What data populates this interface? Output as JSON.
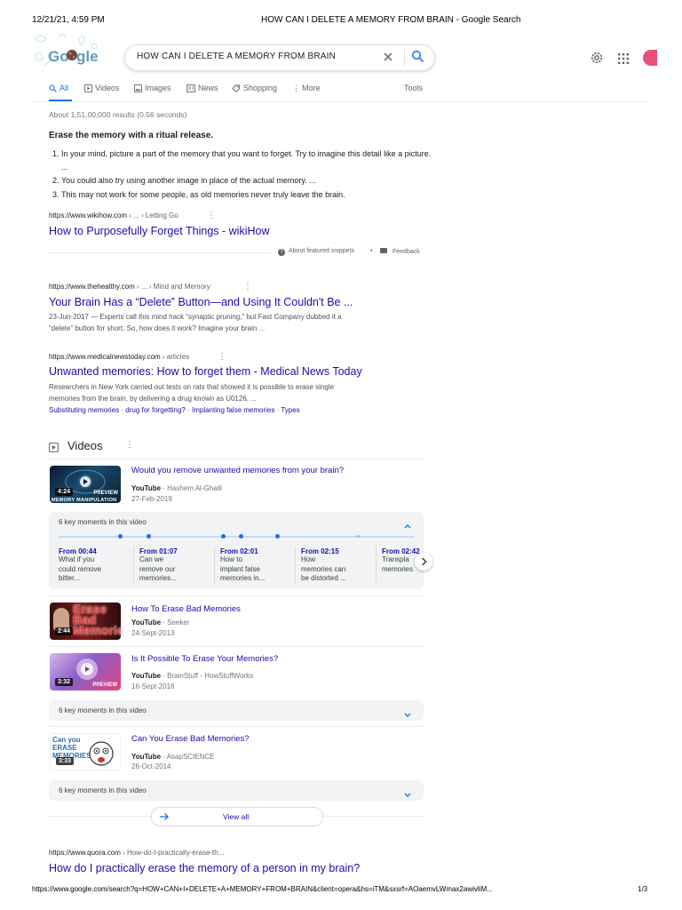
{
  "print_header": {
    "datetime": "12/21/21, 4:59 PM",
    "page_title": "HOW CAN I DELETE A MEMORY FROM BRAIN - Google Search"
  },
  "search": {
    "query": "HOW CAN I DELETE A MEMORY FROM BRAIN"
  },
  "tabs": [
    {
      "label": "All",
      "icon": "search-icon",
      "active": true
    },
    {
      "label": "Videos",
      "icon": "play-icon"
    },
    {
      "label": "Images",
      "icon": "image-icon"
    },
    {
      "label": "News",
      "icon": "news-icon"
    },
    {
      "label": "Shopping",
      "icon": "tag-icon"
    },
    {
      "label": "More",
      "icon": "more-dots-icon"
    },
    {
      "label": "Tools"
    }
  ],
  "stats": "About 1,51,00,000 results (0.56 seconds)",
  "featured": {
    "title": "Erase the memory with a ritual release.",
    "items": [
      "In your mind, picture a part of the memory that you want to forget. Try to imagine this detail like a picture. ...",
      "You could also try using another image in place of the actual memory. ...",
      "This may not work for some people, as old memories never truly leave the brain."
    ],
    "cite_url": "https://www.wikihow.com",
    "cite_path": " › ... › Letting Go",
    "link_title": "How to Purposefully Forget Things - wikiHow",
    "about_label": "About featured snippets",
    "bullet": "•",
    "feedback_label": "Feedback"
  },
  "results": [
    {
      "url": "https://www.thehealthy.com",
      "path": " › ... › Mind and Memory",
      "title": "Your Brain Has a “Delete” Button—and Using It Couldn't Be ...",
      "snippet_1": "23-Jun-2017 — Experts call this mind hack “synaptic pruning,” but Fast Company dubbed it a",
      "snippet_2": "“delete” button for short. So, how does it work? Imagine your brain ..."
    },
    {
      "url": "https://www.medicalnewstoday.com",
      "path": " › articles",
      "title": "Unwanted memories: How to forget them - Medical News Today",
      "snippet_1": "Researchers in New York carried out tests on rats that showed it is possible to erase single",
      "snippet_2": "memories from the brain, by delivering a drug known as U0126, ...",
      "sitelinks": [
        "Substituting memories",
        "drug for forgetting?",
        "Implanting false memories",
        "Types"
      ],
      "sitelink_sep": " · "
    }
  ],
  "videos": {
    "heading": "Videos",
    "items": [
      {
        "title": "Would you remove unwanted memories from your brain?",
        "source": "YouTube",
        "author": "Hashem Al-Ghaili",
        "date": "27-Feb-2019",
        "duration": "4:24",
        "thumb_caption": "MEMORY MANIPULATION",
        "thumb_badge": "PREVIEW"
      },
      {
        "title": "How To Erase Bad Memories",
        "source": "YouTube",
        "author": "Seeker",
        "date": "24-Sept-2013",
        "duration": "2:44",
        "thumb_text": "Erase Bad Memories"
      },
      {
        "title": "Is It Possible To Erase Your Memories?",
        "source": "YouTube",
        "author": "BrainStuff - HowStuffWorks",
        "date": "16-Sept-2016",
        "duration": "3:32",
        "thumb_badge": "PREVIEW"
      },
      {
        "title": "Can You Erase Bad Memories?",
        "source": "YouTube",
        "author": "AsapSCIENCE",
        "date": "26-Oct-2014",
        "duration": "3:33",
        "thumb_text": "Can you ERASE MEMORIES"
      }
    ],
    "key_moments_label": "6 key moments in this video",
    "key_moments": [
      {
        "time": "From 00:44",
        "desc": [
          "What if you",
          "could remove",
          "bitter..."
        ]
      },
      {
        "time": "From 01:07",
        "desc": [
          "Can we",
          "remove our",
          "memories..."
        ]
      },
      {
        "time": "From 02:01",
        "desc": [
          "How to",
          "implant false",
          "memories in..."
        ]
      },
      {
        "time": "From 02:15",
        "desc": [
          "How",
          "memories can",
          "be distorted ..."
        ]
      },
      {
        "time": "From 02:42",
        "desc": [
          "Transpla",
          "memories"
        ]
      }
    ],
    "view_all": "View all"
  },
  "quora": {
    "url": "https://www.quora.com",
    "path": " › How-do-I-practically-erase-th...",
    "title": "How do I practically erase the memory of a person in my brain?"
  },
  "print_footer": {
    "url": "https://www.google.com/search?q=HOW+CAN+I+DELETE+A+MEMORY+FROM+BRAIN&client=opera&hs=iTM&sxsrf=AOaemvLWmax2awivliM...",
    "page": "1/3"
  },
  "colors": {
    "link": "#1a0dab",
    "accent": "#1a73e8",
    "avatar": "#e8507a"
  }
}
